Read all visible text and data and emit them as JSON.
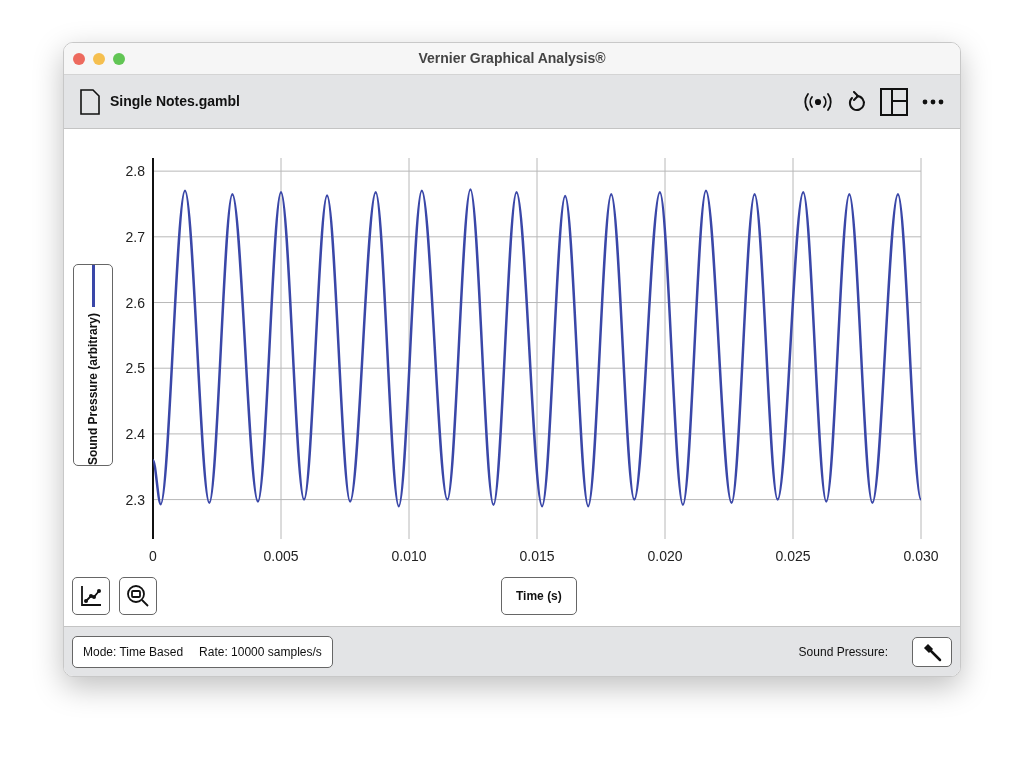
{
  "window": {
    "title": "Vernier Graphical Analysis®"
  },
  "toolbar": {
    "file_name": "Single Notes.gambl"
  },
  "graph": {
    "chart_data": {
      "type": "line",
      "grid": true,
      "xlabel": "Time (s)",
      "ylabel": "Sound Pressure (arbitrary)",
      "xlim": [
        0,
        0.03
      ],
      "ylim": [
        2.24,
        2.82
      ],
      "xticks": [
        {
          "value": 0,
          "label": "0"
        },
        {
          "value": 0.005,
          "label": "0.005"
        },
        {
          "value": 0.01,
          "label": "0.010"
        },
        {
          "value": 0.015,
          "label": "0.015"
        },
        {
          "value": 0.02,
          "label": "0.020"
        },
        {
          "value": 0.025,
          "label": "0.025"
        },
        {
          "value": 0.03,
          "label": "0.030"
        }
      ],
      "yticks": [
        {
          "value": 2.3,
          "label": "2.3"
        },
        {
          "value": 2.4,
          "label": "2.4"
        },
        {
          "value": 2.5,
          "label": "2.5"
        },
        {
          "value": 2.6,
          "label": "2.6"
        },
        {
          "value": 2.7,
          "label": "2.7"
        },
        {
          "value": 2.8,
          "label": "2.8"
        }
      ],
      "x": [
        0,
        0.0003,
        0.00125,
        0.0022,
        0.0031,
        0.0041,
        0.005,
        0.0059,
        0.0068,
        0.0077,
        0.0087,
        0.0096,
        0.0105,
        0.0115,
        0.0124,
        0.0133,
        0.0142,
        0.0152,
        0.0161,
        0.017,
        0.0179,
        0.0188,
        0.0198,
        0.0207,
        0.0216,
        0.0226,
        0.0235,
        0.0244,
        0.0254,
        0.0263,
        0.0272,
        0.0281,
        0.0291,
        0.03
      ],
      "series": [
        {
          "color": "#3a47a8",
          "values": [
            2.36,
            2.293,
            2.77,
            2.295,
            2.765,
            2.297,
            2.768,
            2.3,
            2.763,
            2.297,
            2.768,
            2.29,
            2.77,
            2.3,
            2.772,
            2.292,
            2.768,
            2.29,
            2.762,
            2.29,
            2.765,
            2.3,
            2.768,
            2.292,
            2.77,
            2.295,
            2.765,
            2.3,
            2.768,
            2.297,
            2.765,
            2.295,
            2.765,
            2.3
          ]
        }
      ]
    }
  },
  "status_bar": {
    "mode": "Mode: Time Based",
    "rate": "Rate: 10000 samples/s",
    "sensor_label": "Sound Pressure:"
  }
}
